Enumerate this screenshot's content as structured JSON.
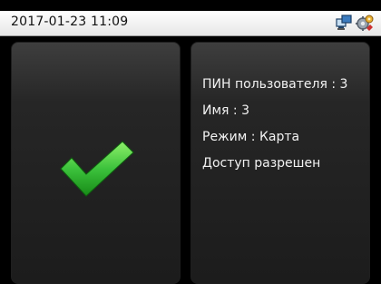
{
  "status_bar": {
    "datetime": "2017-01-23 11:09",
    "icons": [
      "network-icon",
      "settings-gear-icon"
    ]
  },
  "result": {
    "icon": "checkmark-icon",
    "accent_color": "#3cc23c"
  },
  "info": {
    "lines": [
      "ПИН пользователя : 3",
      "Имя : 3",
      "Режим : Карта",
      "Доступ разрешен"
    ]
  }
}
